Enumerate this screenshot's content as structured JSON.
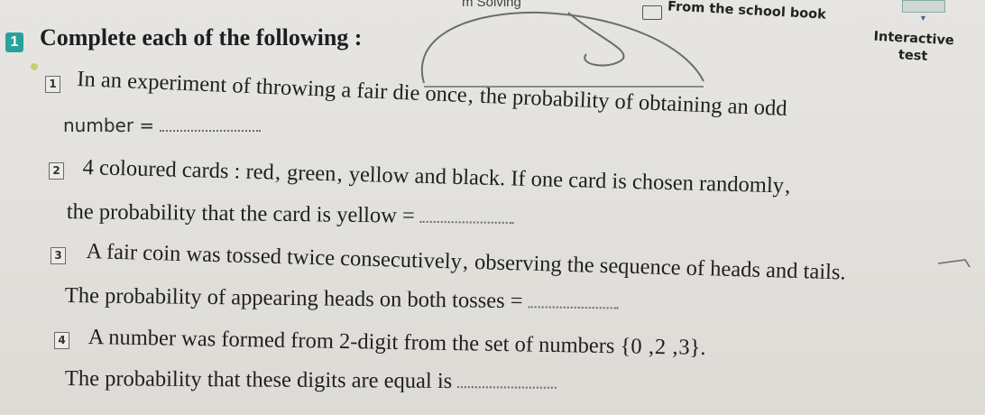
{
  "header": {
    "problem_solving": "m Solving",
    "from_school_book": "From the school book",
    "interactive_line1": "Interactive",
    "interactive_line2": "test"
  },
  "exercise": {
    "number": "1",
    "title": "Complete each of the following :"
  },
  "questions": [
    {
      "number": "1",
      "line1": "In an experiment of throwing a fair die once‚ the probability of obtaining an odd",
      "line2": "number ="
    },
    {
      "number": "2",
      "line1": "4 coloured cards : red‚ green‚ yellow and black. If one card is chosen randomly‚",
      "line2": "the probability that the card is yellow ="
    },
    {
      "number": "3",
      "line1": "A fair coin was tossed twice consecutively‚ observing the sequence of heads and tails.",
      "line2": "The probability of appearing heads on both tosses ="
    },
    {
      "number": "4",
      "line1": "A number was formed from 2-digit from the set of numbers {0 ‚2 ‚3}.",
      "line2": "The probability that these digits are equal is"
    }
  ]
}
